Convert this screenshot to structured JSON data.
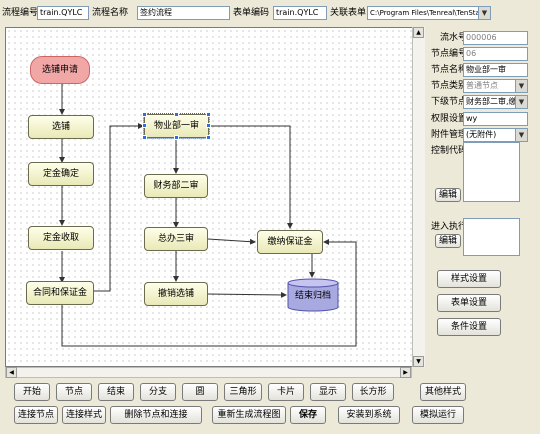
{
  "topbar": {
    "process_id_label": "流程编号",
    "process_id_value": "train.QYLC",
    "process_name_label": "流程名称",
    "process_name_value": "签约流程",
    "form_id_label": "表单编码",
    "form_id_value": "train.QYLC",
    "linked_form_label": "关联表单",
    "linked_form_value": "C:\\Program Files\\Tenreal\\TenStar_TS_QJB\\"
  },
  "nodes": {
    "start": "选铺申请",
    "n1": "选铺",
    "n2": "定金确定",
    "n3": "定金收取",
    "n4": "合同和保证金",
    "n5": "物业部一审",
    "n6": "财务部二审",
    "n7": "总办三审",
    "n8": "撤销选铺",
    "n9": "缴纳保证金",
    "end": "结束归档"
  },
  "panel": {
    "serial_label": "流水号",
    "serial_value": "000006",
    "node_no_label": "节点编号",
    "node_no_value": "06",
    "node_name_label": "节点名称",
    "node_name_value": "物业部一审",
    "node_type_label": "节点类别",
    "node_type_value": "普通节点",
    "next_node_label": "下级节点",
    "next_node_value": "财务部二审,缴",
    "perm_label": "权限设置",
    "perm_value": "wy",
    "attach_label": "附件管理",
    "attach_value": "(无附件)",
    "control_code_label": "控制代码",
    "edit1_label": "编辑",
    "enter_exec_label": "进入执行",
    "edit2_label": "编辑",
    "style_btn": "样式设置",
    "form_btn": "表单设置",
    "cond_btn": "条件设置"
  },
  "toolbar1": [
    "开始",
    "节点",
    "结束",
    "分支",
    "圆",
    "三角形",
    "卡片",
    "显示",
    "长方形",
    "其他样式"
  ],
  "toolbar2": [
    "连接节点",
    "连接样式",
    "删除节点和连接",
    "重新生成流程图",
    "保存",
    "安装到系统",
    "模拟运行"
  ]
}
